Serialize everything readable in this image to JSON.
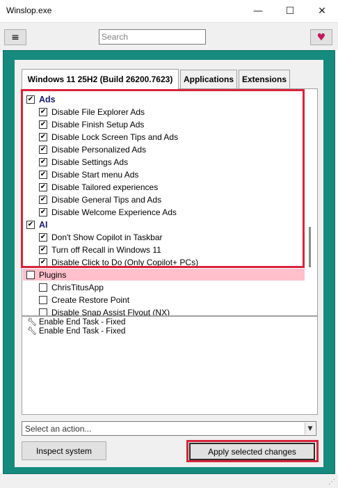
{
  "window": {
    "title": "Winslop.exe",
    "minimize_glyph": "—",
    "maximize_glyph": "☐",
    "close_glyph": "✕"
  },
  "toolbar": {
    "menu_glyph": "≡",
    "search_placeholder": "Search",
    "heart_glyph": "♥"
  },
  "tabs": [
    {
      "label": "Windows 11 25H2 (Build 26200.7623)",
      "active": true
    },
    {
      "label": "Applications",
      "active": false
    },
    {
      "label": "Extensions",
      "active": false
    }
  ],
  "check_glyph": "✔",
  "features": {
    "ads": {
      "label": "Ads",
      "checked": true,
      "items": [
        {
          "label": "Disable File Explorer Ads",
          "checked": true
        },
        {
          "label": "Disable Finish Setup Ads",
          "checked": true
        },
        {
          "label": "Disable Lock Screen Tips and Ads",
          "checked": true
        },
        {
          "label": "Disable Personalized Ads",
          "checked": true
        },
        {
          "label": "Disable Settings Ads",
          "checked": true
        },
        {
          "label": "Disable Start menu Ads",
          "checked": true
        },
        {
          "label": "Disable Tailored experiences",
          "checked": true
        },
        {
          "label": "Disable General Tips and Ads",
          "checked": true
        },
        {
          "label": "Disable Welcome Experience Ads",
          "checked": true
        }
      ]
    },
    "ai": {
      "label": "AI",
      "checked": true,
      "items": [
        {
          "label": "Don't Show Copilot in Taskbar",
          "checked": true
        },
        {
          "label": "Turn off Recall in Windows 11",
          "checked": true
        },
        {
          "label": "Disable Click to Do (Only Copilot+ PCs)",
          "checked": true
        }
      ]
    },
    "plugins": {
      "label": "Plugins",
      "checked": false,
      "items": [
        {
          "label": "ChrisTitusApp",
          "checked": false
        },
        {
          "label": "Create Restore Point",
          "checked": false
        },
        {
          "label": "Disable Snap Assist Flyout (NX)",
          "checked": false
        }
      ]
    }
  },
  "log": {
    "icon": "wrench-icon",
    "lines": [
      "Enable End Task - Fixed",
      "Enable End Task - Fixed"
    ]
  },
  "action_select": {
    "placeholder": "Select an action...",
    "arrow_glyph": "▼"
  },
  "buttons": {
    "inspect": "Inspect system",
    "apply": "Apply selected changes"
  },
  "colors": {
    "teal_frame": "#178a7e",
    "highlight_border": "#d6243a",
    "plugins_band": "#ffc0cb",
    "category_text": "#1a1a6e"
  }
}
